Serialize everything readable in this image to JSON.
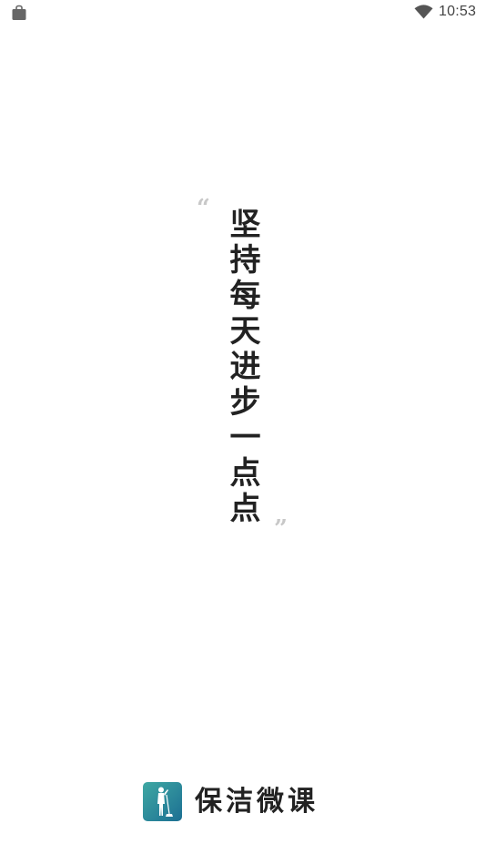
{
  "status_bar": {
    "time": "10:53",
    "left_icon": "shopping-bag-icon",
    "right_icon": "wifi-icon"
  },
  "splash": {
    "open_quote": "“",
    "slogan": "坚持每天进步一点点",
    "close_quote": "”"
  },
  "brand": {
    "logo_icon": "cleaner-silhouette-logo",
    "name": "保洁微课",
    "logo_gradient": [
      "#3fa8a3",
      "#1c6f93"
    ]
  }
}
